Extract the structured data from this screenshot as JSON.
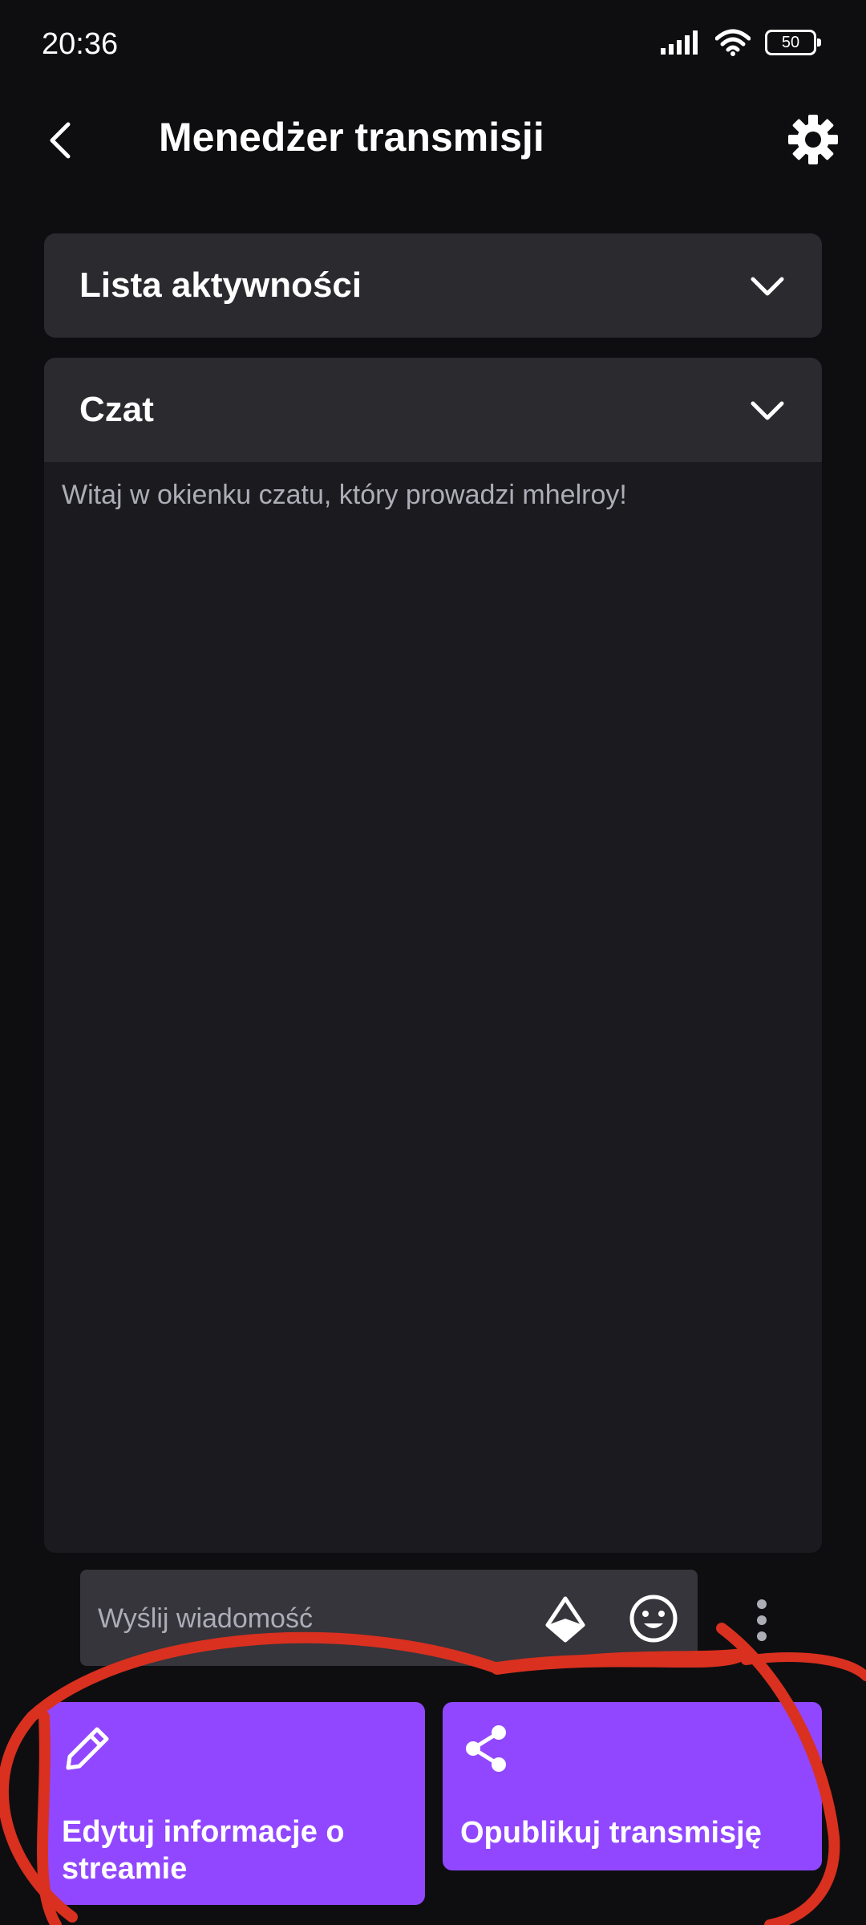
{
  "status_bar": {
    "time": "20:36",
    "battery": "50"
  },
  "header": {
    "title": "Menedżer transmisji"
  },
  "panels": {
    "activity": {
      "title": "Lista aktywności"
    },
    "chat": {
      "title": "Czat",
      "welcome": "Witaj w okienku czatu, który prowadzi mhelroy!"
    }
  },
  "chat_input": {
    "placeholder": "Wyślij wiadomość"
  },
  "actions": {
    "edit_label": "Edytuj informacje o streamie",
    "share_label": "Opublikuj transmisję"
  },
  "colors": {
    "background": "#0e0e10",
    "panel_header": "#2a2a2f",
    "accent": "#9147ff",
    "annotation": "#d9301f"
  },
  "icons": {
    "back": "chevron-left-icon",
    "settings": "gear-icon",
    "expand": "chevron-down-icon",
    "bits": "bits-icon",
    "emote": "smiley-icon",
    "more": "more-vertical-icon",
    "edit": "pencil-icon",
    "share": "share-icon"
  }
}
